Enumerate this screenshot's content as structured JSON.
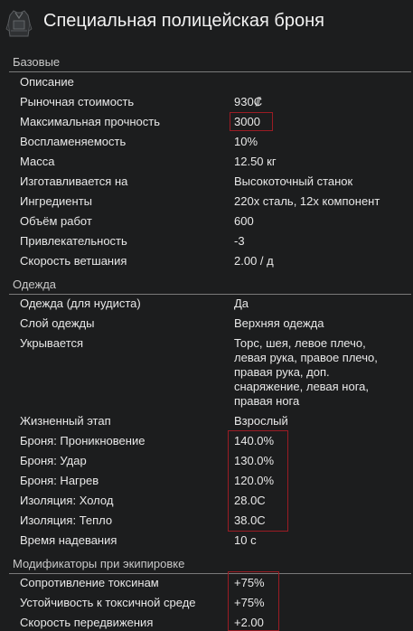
{
  "window": {
    "title": "Специальная полицейская броня",
    "icon": "armor-vest-icon"
  },
  "sections": {
    "basic": "Базовые",
    "clothing": "Одежда",
    "equip_modifiers": "Модификаторы при экипировке"
  },
  "basic_rows": {
    "description": {
      "label": "Описание"
    },
    "market_value": {
      "label": "Рыночная стоимость",
      "value": "930₡"
    },
    "max_hp": {
      "label": "Максимальная прочность",
      "value": "3000"
    },
    "flammability": {
      "label": "Воспламеняемость",
      "value": "10%"
    },
    "mass": {
      "label": "Масса",
      "value": "12.50 кг"
    },
    "crafted_at": {
      "label": "Изготавливается на",
      "value": "Высокоточный станок"
    },
    "ingredients": {
      "label": "Ингредиенты",
      "value": "220x сталь, 12x компонент"
    },
    "work_to_make": {
      "label": "Объём работ",
      "value": "600"
    },
    "beauty": {
      "label": "Привлекательность",
      "value": "-3"
    },
    "deterioration": {
      "label": "Скорость ветшания",
      "value": "2.00 / д"
    }
  },
  "clothing_rows": {
    "nudist": {
      "label": "Одежда (для нудиста)",
      "value": "Да"
    },
    "layer": {
      "label": "Слой одежды",
      "value": "Верхняя одежда"
    },
    "covers": {
      "label": "Укрывается",
      "value": "Торс, шея, левое плечо, левая рука, правое плечо, правая рука, доп. снаряжение, левая нога, правая нога"
    },
    "life_stage": {
      "label": "Жизненный этап",
      "value": "Взрослый"
    },
    "armor_sharp": {
      "label": "Броня: Проникновение",
      "value": "140.0%"
    },
    "armor_blunt": {
      "label": "Броня: Удар",
      "value": "130.0%"
    },
    "armor_heat": {
      "label": "Броня: Нагрев",
      "value": "120.0%"
    },
    "insulation_cold": {
      "label": "Изоляция: Холод",
      "value": "28.0C"
    },
    "insulation_heat": {
      "label": "Изоляция: Тепло",
      "value": "38.0C"
    },
    "equip_delay": {
      "label": "Время надевания",
      "value": "10 с"
    }
  },
  "modifier_rows": {
    "toxic_resistance": {
      "label": "Сопротивление токсинам",
      "value": "+75%"
    },
    "toxic_env_resistance": {
      "label": "Устойчивость к токсичной среде",
      "value": "+75%"
    },
    "move_speed": {
      "label": "Скорость передвижения",
      "value": "+2.00"
    }
  },
  "colors": {
    "background": "#1c1d1e",
    "text": "#e8e8e8",
    "divider": "#7a7a7a",
    "highlight_box": "#9b1c24"
  }
}
